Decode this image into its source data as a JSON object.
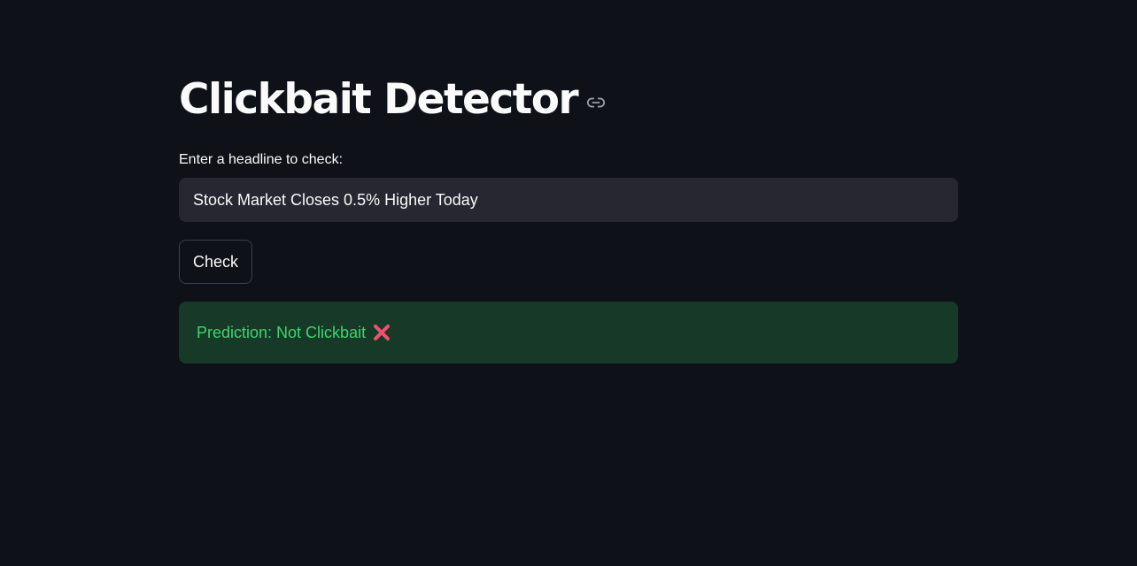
{
  "app": {
    "title": "Clickbait Detector"
  },
  "input": {
    "label": "Enter a headline to check:",
    "value": "Stock Market Closes 0.5% Higher Today"
  },
  "button": {
    "check_label": "Check"
  },
  "result": {
    "text": "Prediction: Not Clickbait",
    "icon": "cross-mark-icon"
  },
  "colors": {
    "background": "#0e1117",
    "input_background": "#262730",
    "success_background": "#173928",
    "success_text": "#3dd56d",
    "cross_mark": "#f0506e"
  }
}
